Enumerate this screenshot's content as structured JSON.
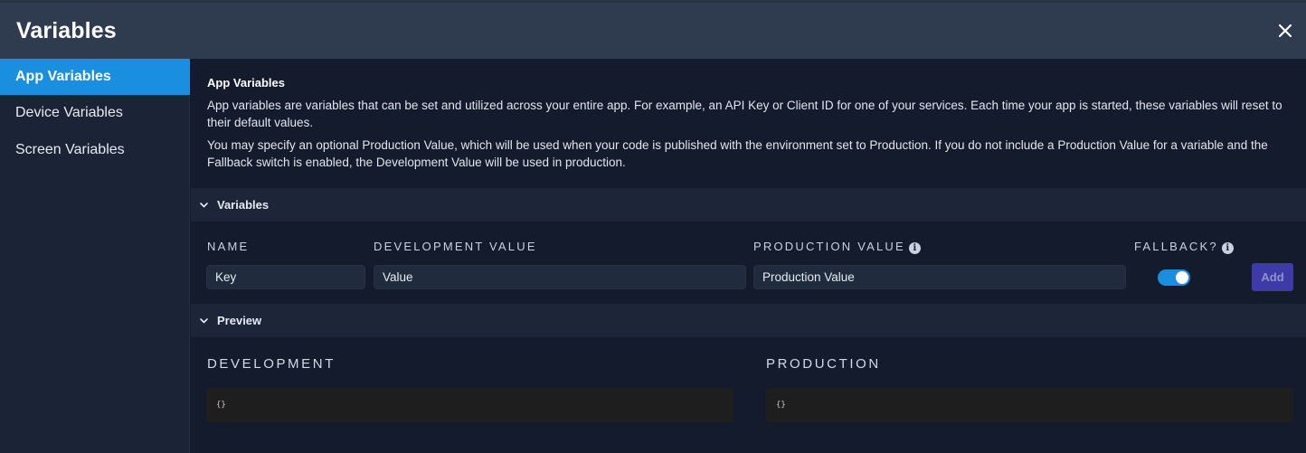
{
  "header": {
    "title": "Variables",
    "close_icon": "close-icon"
  },
  "sidebar": {
    "items": [
      {
        "label": "App Variables",
        "active": true
      },
      {
        "label": "Device Variables",
        "active": false
      },
      {
        "label": "Screen Variables",
        "active": false
      }
    ]
  },
  "intro": {
    "title": "App Variables",
    "paragraph1": "App variables are variables that can be set and utilized across your entire app. For example, an API Key or Client ID for one of your services. Each time your app is started, these variables will reset to their default values.",
    "paragraph2": "You may specify an optional Production Value, which will be used when your code is published with the environment set to Production. If you do not include a Production Value for a variable and the Fallback switch is enabled, the Development Value will be used in production."
  },
  "variables_section": {
    "label": "Variables",
    "columns": {
      "name": "NAME",
      "development": "DEVELOPMENT VALUE",
      "production": "PRODUCTION VALUE",
      "fallback": "FALLBACK?"
    },
    "inputs": {
      "name_placeholder": "Key",
      "development_placeholder": "Value",
      "production_placeholder": "Production Value"
    },
    "fallback_enabled": true,
    "add_label": "Add"
  },
  "preview_section": {
    "label": "Preview",
    "development_label": "DEVELOPMENT",
    "production_label": "PRODUCTION",
    "development_value": "{}",
    "production_value": "{}"
  },
  "colors": {
    "accent": "#1a8fe0",
    "add_button": "#3c3ba8",
    "header_bg": "#2f3b4e",
    "sidebar_bg": "#1a2436",
    "main_bg": "#131b2c"
  }
}
